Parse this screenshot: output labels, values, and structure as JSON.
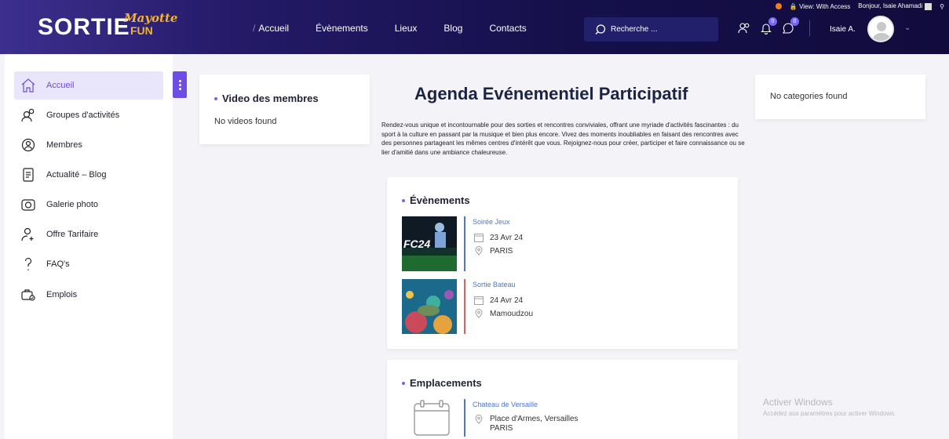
{
  "adminbar": {
    "view_label": "View: With Access",
    "greeting": "Bonjour, Isaie Ahamadi"
  },
  "header": {
    "logo_main": "SORTIE",
    "logo_script": "Mayotte",
    "logo_fun": "FUN",
    "nav": [
      "Accueil",
      "Évènements",
      "Lieux",
      "Blog",
      "Contacts"
    ],
    "search_placeholder": "Recherche ...",
    "badges": {
      "notifications": "0",
      "messages": "0"
    },
    "user_name": "Isaie A."
  },
  "sidebar": {
    "items": [
      {
        "label": "Accueil",
        "icon": "home-icon"
      },
      {
        "label": "Groupes d'activités",
        "icon": "users-icon"
      },
      {
        "label": "Membres",
        "icon": "user-circle-icon"
      },
      {
        "label": "Actualité – Blog",
        "icon": "document-icon"
      },
      {
        "label": "Galerie photo",
        "icon": "camera-icon"
      },
      {
        "label": "Offre Tarifaire",
        "icon": "user-plus-icon"
      },
      {
        "label": "FAQ's",
        "icon": "question-icon"
      },
      {
        "label": "Emplois",
        "icon": "briefcase-icon"
      }
    ]
  },
  "videos": {
    "title": "Video des membres",
    "empty": "No videos found"
  },
  "categories": {
    "empty": "No categories found"
  },
  "main": {
    "title": "Agenda Evénementiel Participatif",
    "intro": "Rendez-vous unique et incontournable pour des sorties et rencontres conviviales, offrant une myriade d'activités fascinantes : du sport à la culture en passant par la musique et bien plus encore. Vivez des moments inoubliables en faisant des rencontres avec des personnes partageant les mêmes centres d'intérêt que vous. Rejoignez-nous pour créer, participer et faire connaissance ou se lier d'amitié dans une ambiance chaleureuse."
  },
  "events": {
    "title": "Évènements",
    "items": [
      {
        "name": "Soirée Jeux",
        "date": "23 Avr 24",
        "place": "PARIS",
        "bar_color": "#4c78c8",
        "thumb_text": "FC24"
      },
      {
        "name": "Sortie Bateau",
        "date": "24 Avr 24",
        "place": "Mamoudzou",
        "bar_color": "#e06060"
      }
    ]
  },
  "locations": {
    "title": "Emplacements",
    "items": [
      {
        "name": "Chateau de Versaille",
        "address_line1": "Place d'Armes, Versailles",
        "address_line2": "PARIS"
      }
    ]
  },
  "watermark": {
    "line1": "Activer Windows",
    "line2": "Accédez aux paramètres pour activer Windows."
  }
}
